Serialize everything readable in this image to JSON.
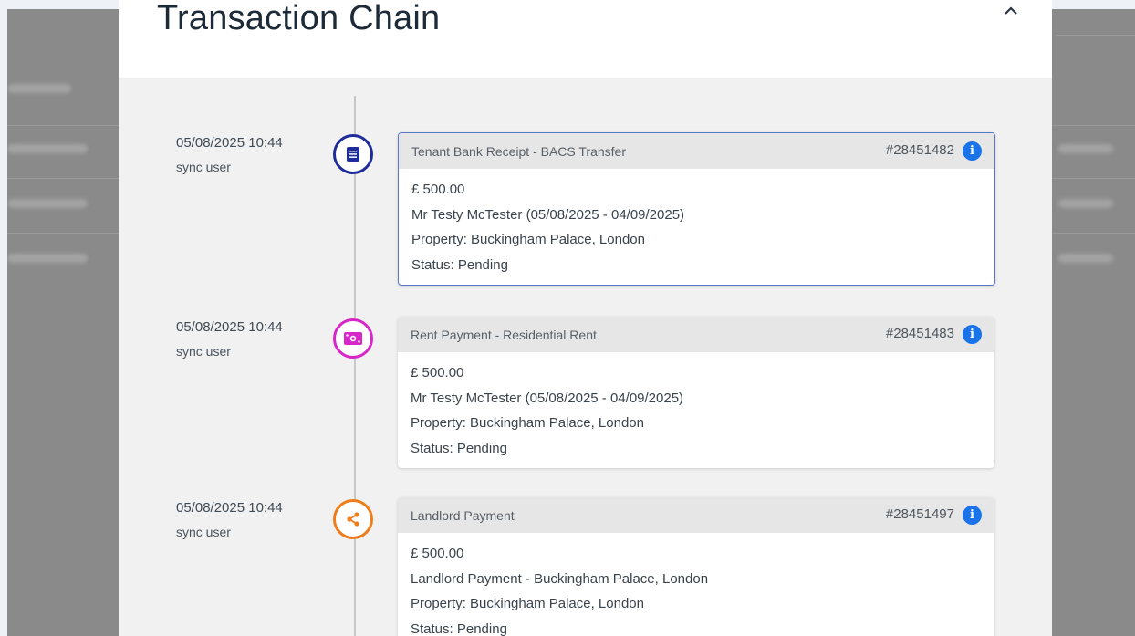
{
  "modal": {
    "title": "Transaction Chain"
  },
  "entries": [
    {
      "date": "05/08/2025 10:44",
      "user": "sync user",
      "icon": "document-icon",
      "color": "#1e2c9a",
      "type": "Tenant Bank Receipt - BACS Transfer",
      "ref": "#28451482",
      "amount": "£ 500.00",
      "description": "Mr Testy McTester (05/08/2025 - 04/09/2025)",
      "property": "Property: Buckingham Palace, London",
      "status": "Status: Pending"
    },
    {
      "date": "05/08/2025 10:44",
      "user": "sync user",
      "icon": "cash-icon",
      "color": "#d827c9",
      "type": "Rent Payment - Residential Rent",
      "ref": "#28451483",
      "amount": "£ 500.00",
      "description": "Mr Testy McTester (05/08/2025 - 04/09/2025)",
      "property": "Property: Buckingham Palace, London",
      "status": "Status: Pending"
    },
    {
      "date": "05/08/2025 10:44",
      "user": "sync user",
      "icon": "share-icon",
      "color": "#ef7d1a",
      "type": "Landlord Payment",
      "ref": "#28451497",
      "amount": "£ 500.00",
      "description": "Landlord Payment - Buckingham Palace, London",
      "property": "Property: Buckingham Palace, London",
      "status": "Status: Pending"
    }
  ],
  "info_glyph": "i",
  "colors": {
    "accent": "#1a73e8",
    "active_border": "#5b78c8"
  }
}
